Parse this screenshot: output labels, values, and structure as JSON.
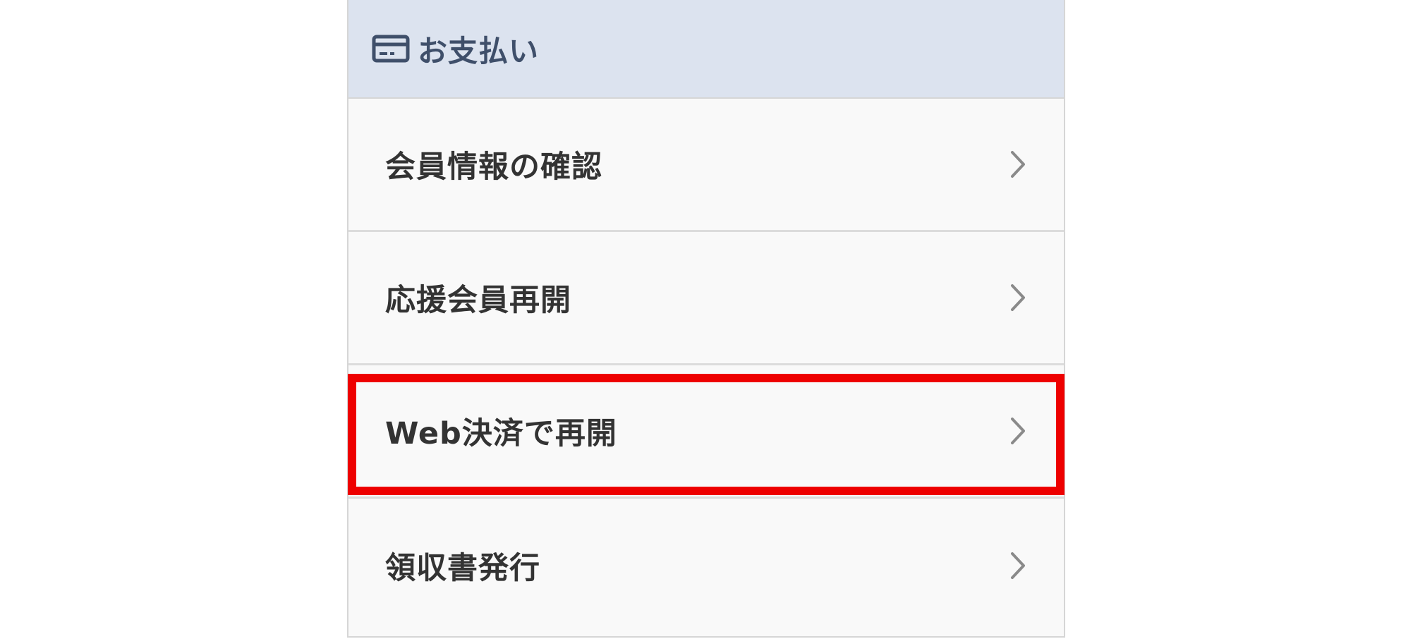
{
  "menu": {
    "header": {
      "icon": "credit-card-icon",
      "title": "お支払い"
    },
    "items": [
      {
        "label": "会員情報の確認",
        "icon": "chevron-right-icon"
      },
      {
        "label": "応援会員再開",
        "icon": "chevron-right-icon"
      },
      {
        "label": "Web決済で再開",
        "icon": "chevron-right-icon",
        "highlighted": true
      },
      {
        "label": "領収書発行",
        "icon": "chevron-right-icon"
      }
    ]
  },
  "colors": {
    "header_bg": "#dce3ef",
    "header_text": "#3f4f6a",
    "item_bg": "#f9f9f9",
    "item_text": "#333333",
    "chevron": "#8a8a8a",
    "highlight": "#ee0000"
  }
}
